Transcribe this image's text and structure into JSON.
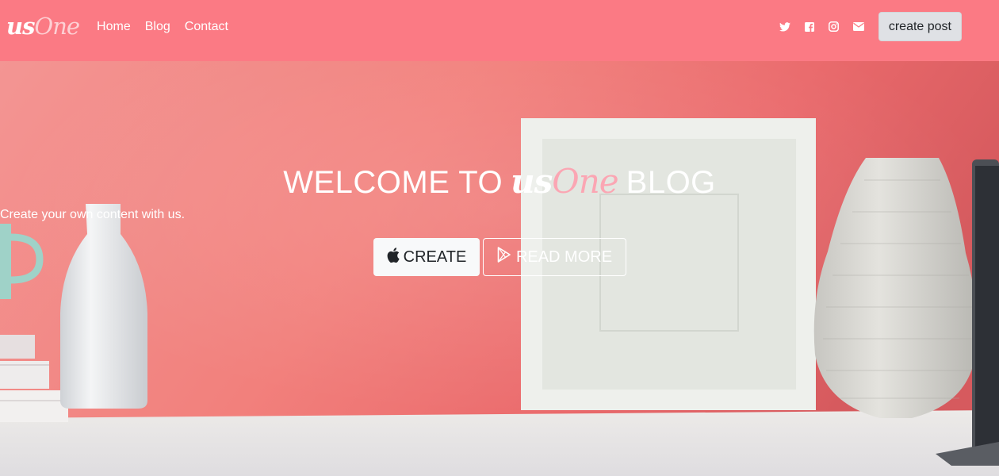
{
  "nav": {
    "brand_us": "us",
    "brand_one": "One",
    "links": [
      "Home",
      "Blog",
      "Contact"
    ],
    "social_icons": [
      "twitter-icon",
      "facebook-icon",
      "instagram-icon",
      "envelope-icon"
    ],
    "create_post_label": "create post",
    "background": "#fb7a84"
  },
  "hero": {
    "title_prefix": "WELCOME TO",
    "title_us": "us",
    "title_one": "One",
    "title_suffix": "BLOG",
    "subtitle": "Create your own content with us.",
    "create_label": "CREATE",
    "read_more_label": "READ MORE",
    "create_icon": "apple-icon",
    "read_more_icon": "play-store-icon"
  }
}
